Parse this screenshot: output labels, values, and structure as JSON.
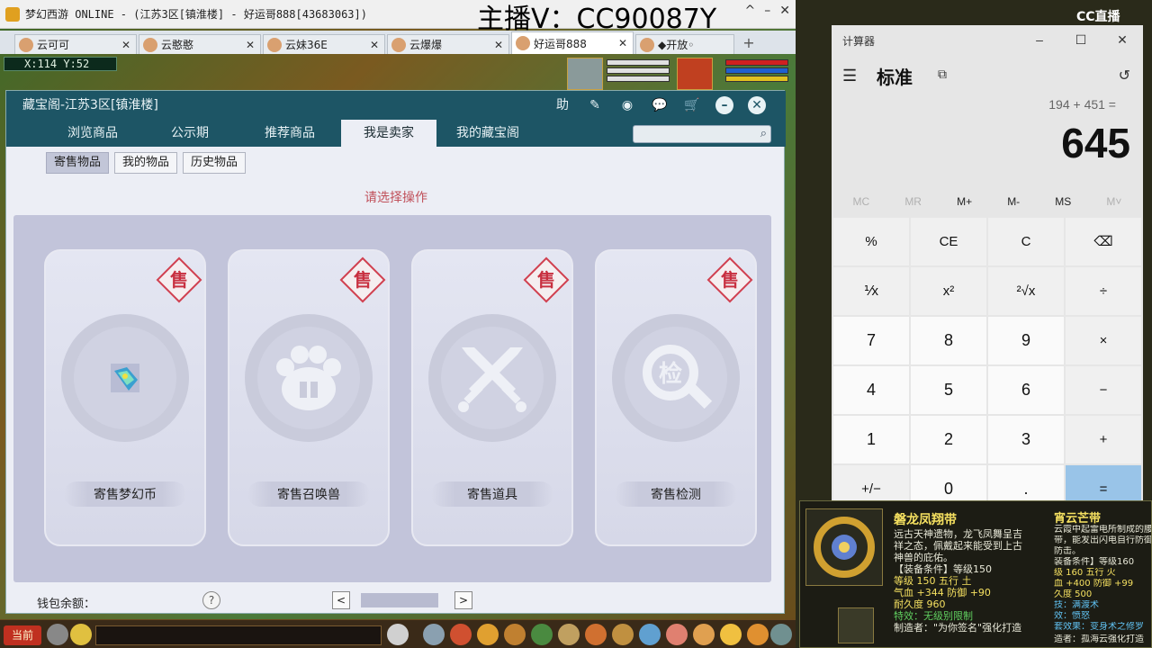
{
  "game": {
    "window_title": "梦幻西游 ONLINE - (江苏3区[镇淮楼] - 好运哥888[43683063])",
    "stream_watermark": "主播V：CC90087Y",
    "tabs": [
      {
        "label": "云可可",
        "active": false
      },
      {
        "label": "云憨憨",
        "active": false
      },
      {
        "label": "云妹36E",
        "active": false
      },
      {
        "label": "云爆爆",
        "active": false
      },
      {
        "label": "好运哥888",
        "active": true
      },
      {
        "label": "◆开放◦",
        "active": false
      }
    ],
    "coords": "X:114 Y:52"
  },
  "pavilion": {
    "title": "藏宝阁-江苏3区[镇淮楼]",
    "header_icons": [
      "help-icon",
      "edit-icon",
      "record-icon",
      "chat-icon",
      "cart-icon"
    ],
    "help_glyph": "助",
    "tabs": [
      "浏览商品",
      "公示期",
      "推荐商品",
      "我是卖家",
      "我的藏宝阁"
    ],
    "active_tab": "我是卖家",
    "search_placeholder": "",
    "sub_tabs": [
      "寄售物品",
      "我的物品",
      "历史物品"
    ],
    "active_sub_tab": "寄售物品",
    "prompt": "请选择操作",
    "badge_text": "售",
    "cards": [
      {
        "label": "寄售梦幻币",
        "icon": "gem-icon"
      },
      {
        "label": "寄售召唤兽",
        "icon": "paw-icon"
      },
      {
        "label": "寄售道具",
        "icon": "crossed-swords-icon"
      },
      {
        "label": "寄售检测",
        "icon": "inspect-icon",
        "icon_text": "检"
      }
    ],
    "wallet_label": "钱包余额：",
    "help_btn": "?",
    "prev_btn": "<",
    "next_btn": ">"
  },
  "bottom_hud": {
    "current_label": "当前"
  },
  "calculator": {
    "title": "计算器",
    "mode": "标准",
    "expression": "194 + 451 =",
    "result": "645",
    "memory_keys": [
      "MC",
      "MR",
      "M+",
      "M-",
      "MS",
      "M˅"
    ],
    "memory_disabled": [
      "MC",
      "MR",
      "M˅"
    ],
    "keys": [
      "%",
      "CE",
      "C",
      "⌫",
      "⅟x",
      "x²",
      "²√x",
      "÷",
      "7",
      "8",
      "9",
      "×",
      "4",
      "5",
      "6",
      "−",
      "1",
      "2",
      "3",
      "+",
      "+/−",
      "0",
      ".",
      "="
    ],
    "accent_color": "#99c4e8"
  },
  "item_tooltip": {
    "name": "磐龙凤翔带",
    "lines": [
      {
        "text": "远古天神遗物，龙飞凤舞呈吉",
        "color": "#e8e8d8"
      },
      {
        "text": "祥之态，佩戴起来能受到上古",
        "color": "#e8e8d8"
      },
      {
        "text": "神兽的庇佑。",
        "color": "#e8e8d8"
      },
      {
        "text": "【装备条件】等级150",
        "color": "#e8e8d8"
      },
      {
        "text": "等级 150  五行 土",
        "color": "#f5e060"
      },
      {
        "text": "气血 +344  防御 +90",
        "color": "#f5e060"
      },
      {
        "text": "耐久度 960",
        "color": "#f5e060"
      },
      {
        "text": "特效：无级别限制",
        "color": "#60d060"
      },
      {
        "text": "制造者：\"为你签名\"强化打造",
        "color": "#e8e8d8"
      }
    ],
    "name2": "宵云芒带",
    "lines2": [
      {
        "text": "云霞中起雷电所制成的腰",
        "color": "#e8e8d8"
      },
      {
        "text": "带，能发出闪电自行防御",
        "color": "#e8e8d8"
      },
      {
        "text": "防击。",
        "color": "#e8e8d8"
      },
      {
        "text": "装备条件】等级160",
        "color": "#e8e8d8"
      },
      {
        "text": "级 160  五行 火",
        "color": "#f5e060"
      },
      {
        "text": "血 +400  防御 +99",
        "color": "#f5e060"
      },
      {
        "text": "久度 500",
        "color": "#f5e060"
      },
      {
        "text": "技：满渡术",
        "color": "#60c0f0"
      },
      {
        "text": "效：愤怒",
        "color": "#60c0f0"
      },
      {
        "text": "套效果：变身术之修罗",
        "color": "#60c0f0"
      },
      {
        "text": "造者：孤海云强化打造",
        "color": "#e8e8d8"
      }
    ]
  },
  "cc_logo": "CC直播"
}
